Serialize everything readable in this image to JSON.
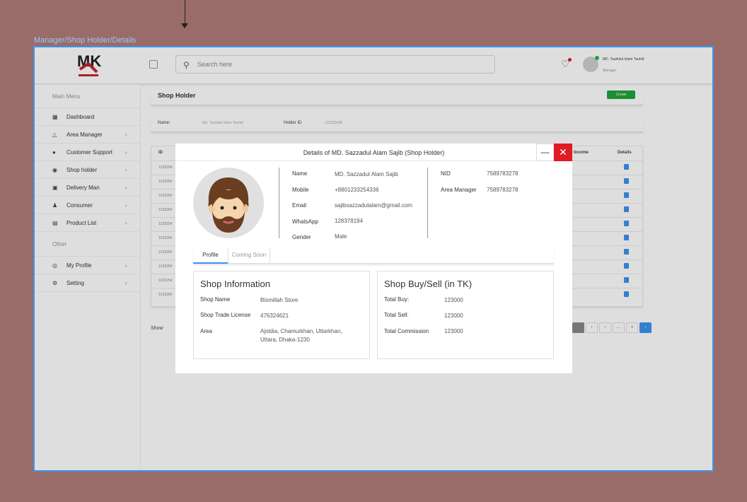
{
  "canvas": {
    "frame_label": "Manager/Shop Holder/Details"
  },
  "topbar": {
    "search_placeholder": "Search here",
    "user_name": "MD. Tauhidul Islam Tauhid",
    "user_role": "Manager"
  },
  "sidebar": {
    "main_menu_label": "Main Menu",
    "other_label": "Other",
    "items": [
      {
        "label": "Dashboard",
        "icon": "dashboard-icon"
      },
      {
        "label": "Area Manager",
        "icon": "area-manager-icon"
      },
      {
        "label": "Customer Support",
        "icon": "support-icon"
      },
      {
        "label": "Shop holder",
        "icon": "shop-icon"
      },
      {
        "label": "Delivery Man",
        "icon": "delivery-icon"
      },
      {
        "label": "Consumer",
        "icon": "consumer-icon"
      },
      {
        "label": "Product List",
        "icon": "product-icon"
      }
    ],
    "other_items": [
      {
        "label": "My Profile",
        "icon": "profile-icon"
      },
      {
        "label": "Setting",
        "icon": "setting-icon"
      }
    ]
  },
  "page": {
    "title": "Shop Holder",
    "create_label": "Create",
    "filter": {
      "name_label": "Name:",
      "name_value": "Md. Tauhidul Islam Tauhid",
      "holder_id_label": "Holder ID",
      "holder_id_value": "123325438"
    },
    "table": {
      "col_id": "ID",
      "col_income": "Income",
      "col_details": "Details",
      "row_ids": [
        "1233254",
        "1233254",
        "1233254",
        "1233254",
        "1233254",
        "1233254",
        "1233254",
        "1233254",
        "1233254",
        "1233254"
      ]
    },
    "show_label": "Show"
  },
  "modal": {
    "title": "Details of MD. Sazzadul Alam Sajib (Shop Holder)",
    "fields": {
      "name_label": "Name",
      "name": "MD. Sazzadul Alam Sajib",
      "mobile_label": "Mobile",
      "mobile": "+8801233254336",
      "email_label": "Email",
      "email": "sajibsazzadulalam@gmail.com",
      "whatsapp_label": "WhatsApp",
      "whatsapp": "128378194",
      "gender_label": "Gender",
      "gender": "Male",
      "nid_label": "NID",
      "nid": "7589783278",
      "area_manager_label": "Area Manager",
      "area_manager": "7589783278"
    },
    "tabs": {
      "profile": "Profile",
      "coming_soon": "Coming Soon"
    },
    "shop_info": {
      "title": "Shop Information",
      "shop_name_label": "Shop Name",
      "shop_name": "Bismillah Store",
      "license_label": "Shop Trade License",
      "license": "476324621",
      "area_label": "Area",
      "area": "Ajoldia, Chamurkhan, Uttarkhan, Uttara, Dhaka-1230"
    },
    "buy_sell": {
      "title": "Shop Buy/Sell (in TK)",
      "total_buy_label": "Total Buy:",
      "total_buy": "123000",
      "total_sell_label": "Total Sell:",
      "total_sell": "123000",
      "commission_label": "Total Commission",
      "commission": "123000"
    }
  },
  "colors": {
    "accent": "#3d92ea",
    "danger": "#e01b24",
    "success": "#1fa53b",
    "canvas_bg": "#996c6a"
  }
}
